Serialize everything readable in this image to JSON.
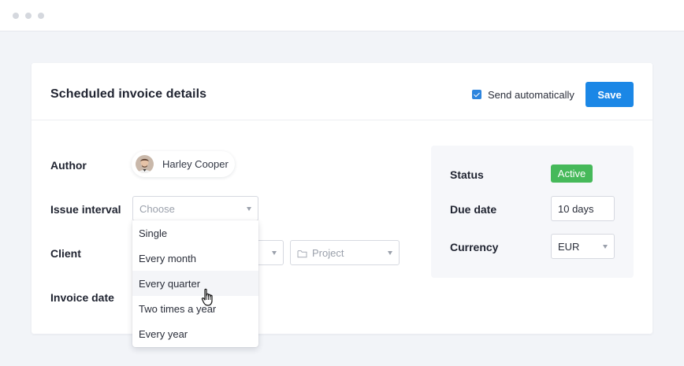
{
  "card": {
    "title": "Scheduled invoice details",
    "send_automatically_label": "Send automatically",
    "send_automatically_checked": true,
    "save_label": "Save"
  },
  "form": {
    "author_label": "Author",
    "author_name": "Harley Cooper",
    "issue_interval_label": "Issue interval",
    "issue_interval_placeholder": "Choose",
    "client_label": "Client",
    "project_placeholder": "Project",
    "invoice_date_label": "Invoice date"
  },
  "dropdown": {
    "options": [
      "Single",
      "Every month",
      "Every quarter",
      "Two times a year",
      "Every year"
    ],
    "hovered": "Every quarter"
  },
  "panel": {
    "status_label": "Status",
    "status_value": "Active",
    "due_date_label": "Due date",
    "due_date_value": "10 days",
    "currency_label": "Currency",
    "currency_value": "EUR"
  },
  "colors": {
    "accent": "#1b87e6",
    "status_active": "#46b95a"
  },
  "icons": [
    "folder-icon",
    "hand-pointer-cursor-icon",
    "checkbox-check-icon",
    "chevron-down-icon"
  ]
}
